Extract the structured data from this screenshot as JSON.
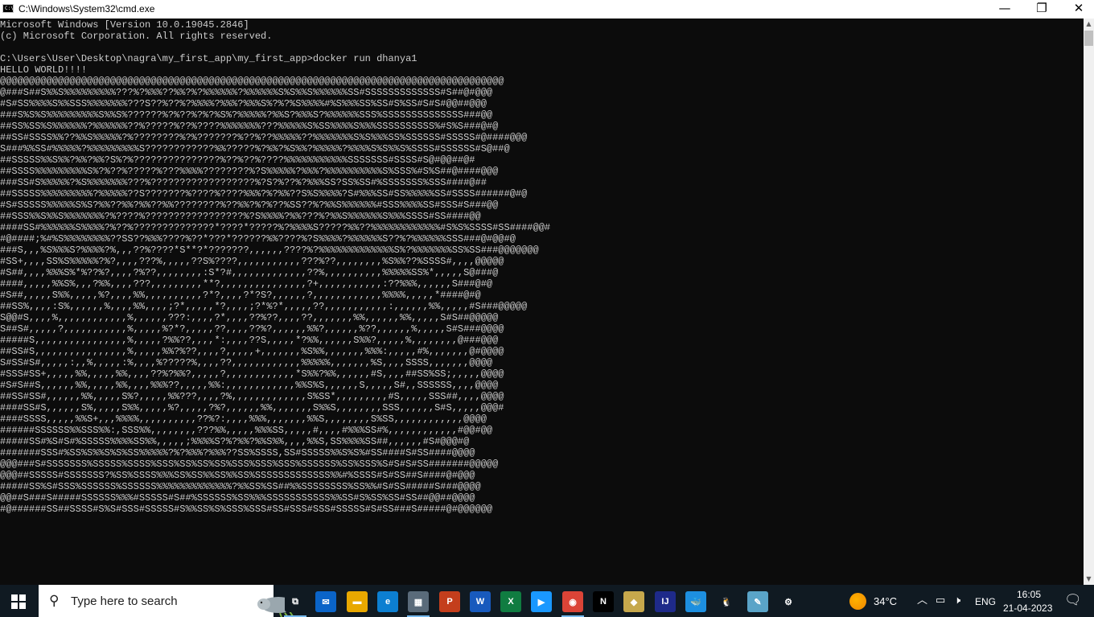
{
  "window": {
    "title": "C:\\Windows\\System32\\cmd.exe",
    "app_icon_text": "C:\\",
    "minimize": "—",
    "maximize": "❐",
    "close": "✕"
  },
  "terminal": {
    "lines": [
      "Microsoft Windows [Version 10.0.19045.2846]",
      "(c) Microsoft Corporation. All rights reserved.",
      "",
      "C:\\Users\\User\\Desktop\\nagra\\my_first_app\\my_first_app>docker run dhanya1",
      "HELLO WORLD!!!!",
      "@@@@@@@@@@@@@@@@@@@@@@@@@@@@@@@@@@@@@@@@@@@@@@@@@@@@@@@@@@@@@@@@@@@@@@@@@@@@@@@@@@@@@@@",
      "@###S##S%%S%%%%%%%%%???%?%%%??%%?%?%%%%%%?%%%%%%S%S%%S%%%%%%SS#SSSSSSSSSSSSS#S##@#@@@",
      "#S#SS%%%%S%%SSS%%%%%%%???S??%??%?%%%%?%%%?%%%S%?%?%S%%%%#%S%%%SS%SS#S%SS#S#S#@@##@@@",
      "###S%S%S%%%%%%%%%S%%S%??????%?%??%?%?%S%?%%%%%?%%S?%%%S?%%%%%%SSS%SSSSSSSSSSSSSS###@@",
      "##SS%SS%S%%%%%%?%%%%%%??%?????%??%????%%%%%%%???%%%%%S%SS%%%%S%%%SSSSSSSSSS%#S%S###@#@",
      "##SS#SSSS%%??%%S%%%%%?%????????%?%???????%??%??%%%%%??%%%%%%%S%S%%%SS%SSSSSS#SSSSS#@####@@@",
      "S###%%SS#%%%%%?%%%%%%%%%S????????????%%?????%?%%?%S%%?%%%%%?%%%%S%S%%S%SSSS#SSSSSS#S@##@",
      "##SSSSS%%S%%?%%?%%?S%?%???????????????%??%??%????%%%%%%%%%%%SSSSSSS#SSSS#S@#@@##@#",
      "##SSSS%%%%%%%%%S%?%??%?????%???%%%%????????%?S%%%%%?%%%?%%%%%%%%%%S%SSS%#S%S##@####@@@",
      "###SS#S%%%%%?%S%%%%%%%???%??????????????????%?S?%??%?%%%SS?SS%SS#%SSSSSSS%SSS####@##",
      "##SSSSS%%%%%%%%%?%%%%%??S???????%????%????%%%?%?%%??S%S%%%%?S#%%%SS#SS%%%%%SS#SSSS######@#@",
      "#S#SSSSS%%%%%S%S?%%??%%?%%??%%????????%??%%?%?%??%SS??%?%%S%%%%%%#SSS%%%%SS#SSS#S###@@",
      "##SSS%%S%%S%%%%%%%?%????%?????????????????%?S%%%%?%%???%?%%S%%%%%%S%%%SSSS#SS####@@",
      "####SS#%%%%%%S%%%%?%??%??????????????*????*?????%?%%%%S?????%%??%%%%%%%%%%%%#S%S%SSSS#SS####@@#",
      "#@####;%#%S%%%%%%%%??SS??%%%????%??*???*??????%%????%?S%%%%?%%%%%%S??%?%%%%%%SSS###@#@@#@",
      "###S,,,%S%%%S?%%%%?%,,,??%????*S**?*???????,,,,,,????%?%%%%%%%%%%%%%S%?%%%%%%%SS%SS###@@@@@@@",
      "#SS+,,,,SS%S%%%%%?%?,,,,???%,,,,,??S%????,,,,,,,,,,,???%??,,,,,,,,%S%%??%SSSS#,,,,@@@@@",
      "#S##,,,,%%%S%*%??%?,,,,?%??,,,,,,,,:S*?#,,,,,,,,,,,,,??%,,,,,,,,,,%%%%%SS%*,,,,,S@###@",
      "####,,,,,%%S%,,,?%%,,,,???,,,,,,,,,**?,,,,,,,,,,,,,,,?+,,,,,,,,,,,:??%%%,,,,,,S###@#@",
      "#S##,,,,,S%%,,,,,%?,,,,%%,,,,,,,,,,?*?,,,,?*?S?,,,,,,?,,,,,,,,,,,,%%%%,,,,,*####@#@",
      "##SS%,,,,:S%,,,,,,%,,,,%%,,,,;?*,,,,,*?,,,,;?*%?*,,,,,??,,,,,,,,,,,:,,,,,,%%,,,,,#S###@@@@@",
      "S@@#S,,,,%,,,,,,,,,,,,%,,,,,,???:,,,,?*,,,,??%??,,,,??,,,,,,,%%,,,,,,%%,,,,,S#S##@@@@@",
      "S##S#,,,,,?,,,,,,,,,,,%,,,,,%?*?,,,,,??,,,,??%?,,,,,,%%?,,,,,,%??,,,,,,%,,,,,S#S###@@@@",
      "#####S,,,,,,,,,,,,,,,,%,,,,,?%%??,,,,*:,,,,??S,,,,,*?%%,,,,,,S%%?,,,,,%,,,,,,,,@###@@@",
      "##SS#S,,,,,,,,,,,,,,,,%,,,,,%%?%??,,,,?,,,,,+,,,,,,,%S%%,,,,,,,%%%:,,,,,#%,,,,,,,@#@@@@",
      "S#SS#S#,,,,,:,,%,,,,,:%,,,,%?????%,,,,??,,,,,,,,,,,,%%%%%,,,,,,,%S,,,,SSSS,,,,,,,@@@@",
      "#SSS#SS+,,,,,%%,,,,,%%,,,,??%?%%?,,,,,?,,,,,,,,,,,,*S%%?%%,,,,,,#S,,,,##SS%SS;,,,,,@@@@",
      "#S#S##S,,,,,,%%,,,,,%%,,,,%%%??,,,,,%%:,,,,,,,,,,,,%%S%S,,,,,,S,,,,,S#,,SSSSSS,,,,@@@@",
      "##SS#SS#,,,,,,%%,,,,,S%?,,,,,%%???,,,,?%,,,,,,,,,,,,,S%SS*,,,,,,,,,#S,,,,,SSS##,,,,@@@@",
      "####SS#S,,,,,,S%,,,,,S%%,,,,,%?,,,,,?%?,,,,,,%%,,,,,,,S%%S,,,,,,,,SSS,,,,,,S#S,,,,,@@@#",
      "####SSSS,,,,,%%S+,,,%%%%,,,,,,,,,,??%?:,,,,%%%,,,,,,,%%S,,,,,,,,S%SS,,,,,,,,,,,,@@@@",
      "######SSSSSS%%SSS%%:,SSS%%,,,,,,,,???%%,,,,,%%%SS,,,,,#,,,,#%%%SS#%,,,,,,,,,,,,#@@#@@",
      "#####SS#%S#S#%SSSSS%%%%SS%%,,,,,;%%%%S?%?%%?%%S%%,,,,%%S,SS%%%%SS##,,,,,,#S#@@@#@",
      "#######SSS#%SS%S%%S%S%SS%%%%%?%?%%%?%%%??SS%SSSS,SS#SSSSS%%S%S%#SS####S#SS####@@@@",
      "@@@###S#SSSSSSS%SSSSS%SSSS%SSS%SS%SS%SS%SSS%SSS%SSS%SSSSSS%SS%SSS%S#S#S#SS#######@@@@@",
      "@@@##SSSSS#SSSSSSS?%SS%SSSS%%%SS%SS%%SS%%SS%SSSSSSSSSSSSS%%#%SSSS#S#SS##S####@#@@@",
      "#####SS%S#SSS%SSSSSS%SSSSSS%%%%%%%%%%%%%?%%SS%SS##%%SSSSSSSS%SS%%#S#SS#####S###@@@@",
      "@@##S###S#####SSSSSS%%%#SSSSS#S##%SSSSSS%SS%%%SSSSSSSSSSS%%SS#S%SS%SS#SS##@@##@@@@",
      "#@######SS##SSSS#S%S#SSS#SSSSS#S%%SS%S%SSS%SSS#SS#SSS#SSS#SSSSS#S#SS###S#####@#@@@@@@"
    ]
  },
  "taskbar": {
    "search_placeholder": "Type here to search",
    "icons": [
      {
        "name": "task-view-icon",
        "glyph": "⧉",
        "color": "#101a22"
      },
      {
        "name": "mail-icon",
        "glyph": "✉",
        "color": "#0a64c8"
      },
      {
        "name": "file-explorer-icon",
        "glyph": "▬",
        "color": "#e8a800"
      },
      {
        "name": "edge-icon",
        "glyph": "e",
        "color": "#0c7fd1"
      },
      {
        "name": "calculator-icon",
        "glyph": "▦",
        "color": "#5a6b7a"
      },
      {
        "name": "powerpoint-icon",
        "glyph": "P",
        "color": "#c43e1c"
      },
      {
        "name": "word-icon",
        "glyph": "W",
        "color": "#185abd"
      },
      {
        "name": "excel-icon",
        "glyph": "X",
        "color": "#107c41"
      },
      {
        "name": "prime-video-icon",
        "glyph": "▶",
        "color": "#1a98ff"
      },
      {
        "name": "chrome-icon",
        "glyph": "◉",
        "color": "#db4437"
      },
      {
        "name": "netflix-icon",
        "glyph": "N",
        "color": "#000000"
      },
      {
        "name": "git-icon",
        "glyph": "◆",
        "color": "#c6a84c"
      },
      {
        "name": "intellij-icon",
        "glyph": "IJ",
        "color": "#1e2a8a"
      },
      {
        "name": "docker-icon",
        "glyph": "🐳",
        "color": "#1d8fe0"
      },
      {
        "name": "linux-icon",
        "glyph": "🐧",
        "color": "#101a22"
      },
      {
        "name": "notepad-icon",
        "glyph": "✎",
        "color": "#5aa4c8"
      },
      {
        "name": "settings-icon",
        "glyph": "⚙",
        "color": "#101a22"
      }
    ],
    "tray": {
      "temperature": "34°C",
      "language": "ENG",
      "time": "16:05",
      "date": "21-04-2023"
    }
  }
}
